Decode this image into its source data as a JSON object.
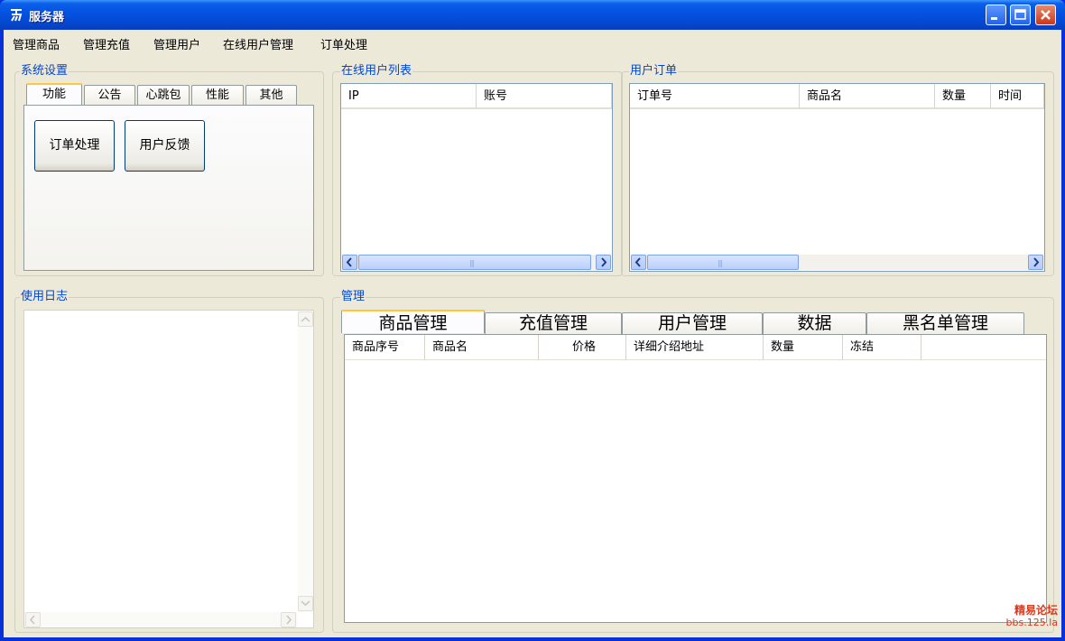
{
  "window": {
    "title": "服务器"
  },
  "menu": [
    "管理商品",
    "管理充值",
    "管理用户",
    "在线用户管理",
    "订单处理"
  ],
  "system_settings": {
    "label": "系统设置",
    "tabs": [
      "功能",
      "公告",
      "心跳包",
      "性能",
      "其他"
    ],
    "active_tab": "功能",
    "buttons": [
      "订单处理",
      "用户反馈"
    ]
  },
  "online_users": {
    "label": "在线用户列表",
    "columns": [
      "IP",
      "账号"
    ],
    "rows": []
  },
  "user_orders": {
    "label": "用户订单",
    "columns": [
      "订单号",
      "商品名",
      "数量",
      "时间"
    ],
    "rows": []
  },
  "usage_log": {
    "label": "使用日志"
  },
  "manage": {
    "label": "管理",
    "tabs": [
      "商品管理",
      "充值管理",
      "用户管理",
      "数据",
      "黑名单管理"
    ],
    "active_tab": "商品管理",
    "columns": [
      "商品序号",
      "商品名",
      "价格",
      "详细介绍地址",
      "数量",
      "冻结"
    ],
    "rows": []
  },
  "watermark": {
    "line1": "精易论坛",
    "line2": "bbs.125.la"
  }
}
